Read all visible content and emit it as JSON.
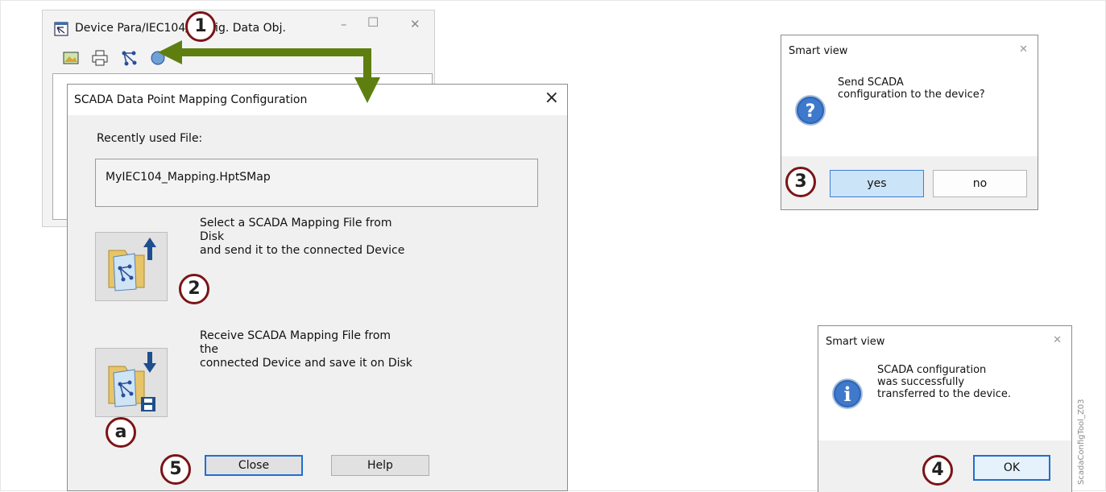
{
  "background_window": {
    "title": "Device Para/IEC104/Config. Data Obj."
  },
  "main_dialog": {
    "title": "SCADA Data Point Mapping Configuration",
    "recent_label": "Recently used File:",
    "recent_file": "MyIEC104_Mapping.HptSMap",
    "send_description": "Select a SCADA Mapping File from\nDisk\nand send it to the connected Device",
    "receive_description": "Receive SCADA Mapping File from\nthe\nconnected Device and save it on Disk",
    "close_label": "Close",
    "help_label": "Help"
  },
  "confirm_dialog": {
    "title": "Smart view",
    "message": "Send SCADA\nconfiguration to the device?",
    "yes_label": "yes",
    "no_label": "no"
  },
  "info_dialog": {
    "title": "Smart view",
    "message": "SCADA configuration\nwas successfully\ntransferred to the device.",
    "ok_label": "OK"
  },
  "callouts": [
    "1",
    "2",
    "3",
    "4",
    "5",
    "a"
  ],
  "figure_id": "ScadaConfigTool_Z03",
  "colors": {
    "callout_border": "#7b1416",
    "arrow": "#5e7f10",
    "focus_border": "#1f6fd1",
    "yes_button": "#cce4f7"
  }
}
